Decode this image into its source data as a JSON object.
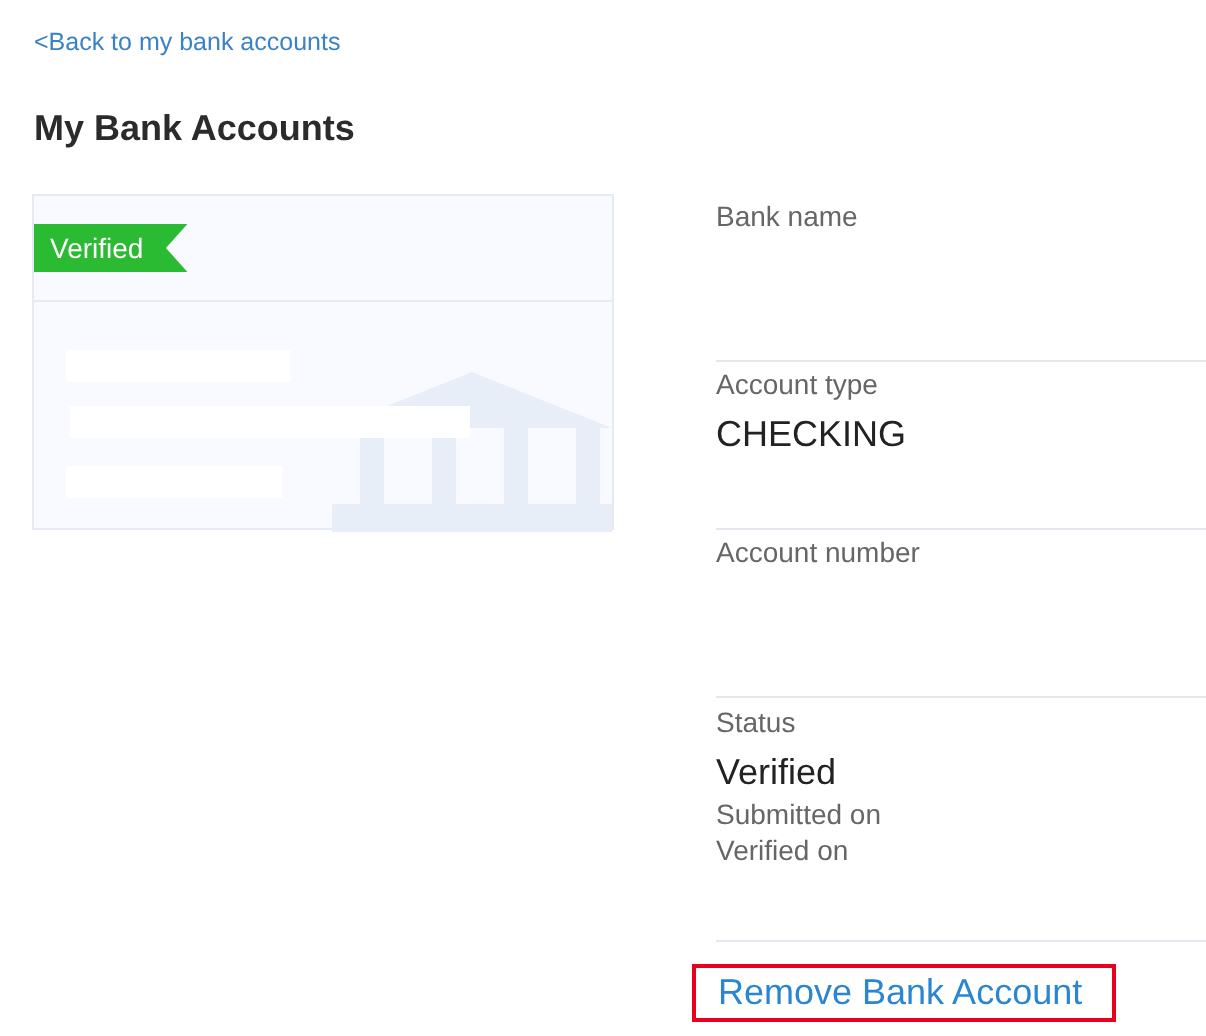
{
  "back_link": "<Back to my bank accounts",
  "title": "My Bank Accounts",
  "card": {
    "badge": "Verified",
    "verified": true
  },
  "details": [
    {
      "label": "Bank name"
    },
    {
      "label": "Account type",
      "value": "CHECKING"
    },
    {
      "label": "Account number"
    },
    {
      "label": "Status",
      "value": "Verified",
      "notes": [
        "Submitted on",
        "Verified on"
      ]
    }
  ],
  "remove_link": {
    "label": "Remove Bank Account",
    "highlighted": true
  }
}
